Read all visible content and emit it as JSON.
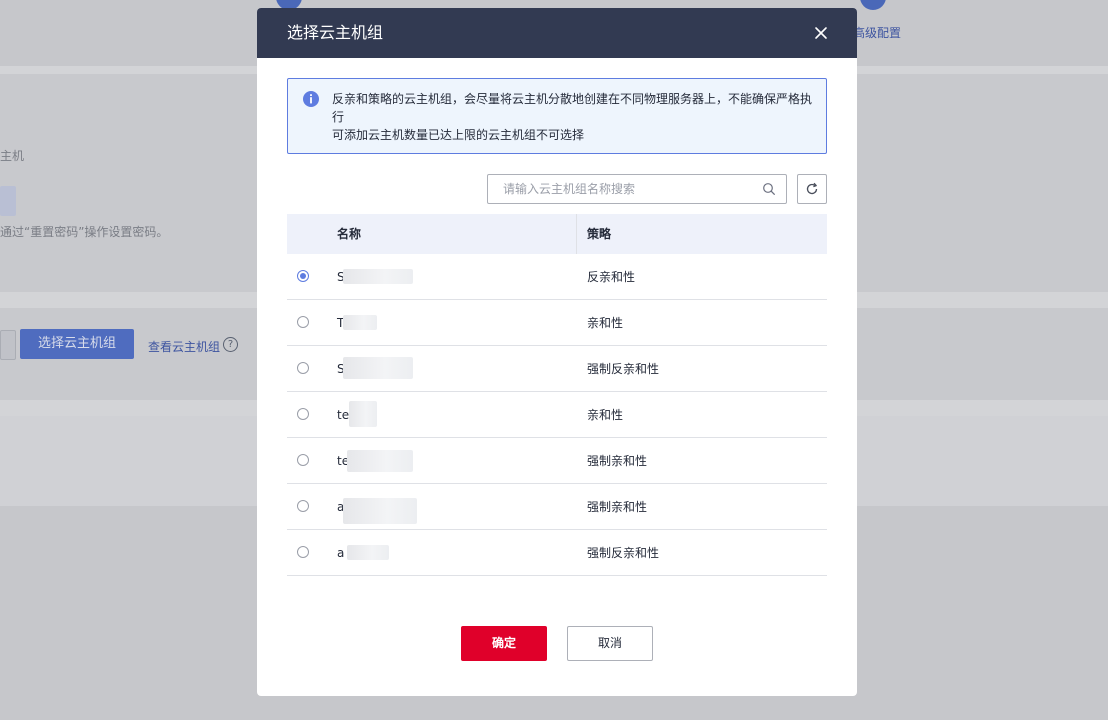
{
  "background": {
    "step_label": "高级配置",
    "ecs_label_fragment": "主机",
    "password_hint_fragment": "通过“重置密码”操作设置密码。",
    "select_group_button": "选择云主机组",
    "view_group_link": "查看云主机组",
    "help_glyph": "?"
  },
  "modal": {
    "title": "选择云主机组",
    "close_glyph": "✕",
    "alert": {
      "line1": "反亲和策略的云主机组，会尽量将云主机分散地创建在不同物理服务器上，不能确保严格执行",
      "line2": "可添加云主机数量已达上限的云主机组不可选择"
    },
    "search": {
      "placeholder": "请输入云主机组名称搜索",
      "value": ""
    },
    "table": {
      "columns": [
        "名称",
        "策略"
      ],
      "rows": [
        {
          "name": "S",
          "policy": "反亲和性",
          "selected": true
        },
        {
          "name": "T",
          "policy": "亲和性",
          "selected": false
        },
        {
          "name": "S",
          "policy": "强制反亲和性",
          "selected": false
        },
        {
          "name": "te",
          "policy": "亲和性",
          "selected": false
        },
        {
          "name": "te",
          "policy": "强制亲和性",
          "selected": false
        },
        {
          "name": "a",
          "policy": "强制亲和性",
          "selected": false
        },
        {
          "name": "a",
          "policy": "强制反亲和性",
          "selected": false
        }
      ]
    },
    "confirm_label": "确定",
    "cancel_label": "取消"
  },
  "colors": {
    "header_bg": "#323a52",
    "accent": "#5e7ce0",
    "confirm_bg": "#e0002a",
    "overlay": "#c6c7cb"
  },
  "icons": [
    "close-icon",
    "info-icon",
    "search-icon",
    "refresh-icon",
    "help-icon"
  ]
}
